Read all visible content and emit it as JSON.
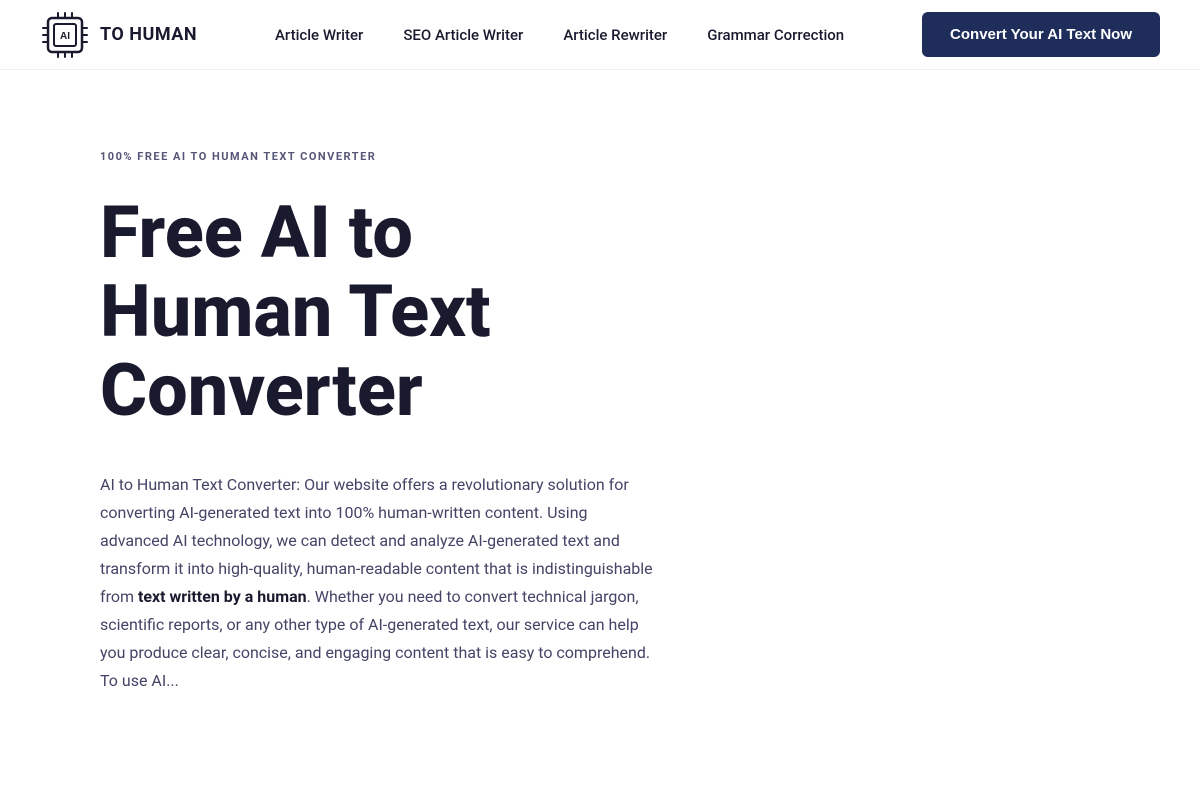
{
  "nav": {
    "logo_alt": "AI to Human Logo",
    "links": [
      {
        "label": "Article Writer",
        "href": "#"
      },
      {
        "label": "SEO Article Writer",
        "href": "#"
      },
      {
        "label": "Article Rewriter",
        "href": "#"
      },
      {
        "label": "Grammar Correction",
        "href": "#"
      }
    ],
    "cta_label": "Convert Your AI Text Now"
  },
  "hero": {
    "badge": "100% FREE AI TO HUMAN TEXT CONVERTER",
    "title": "Free AI to Human Text Converter",
    "description_part1": "AI to Human Text Converter: Our website offers a revolutionary solution for converting AI-generated text into 100% human-written content. Using advanced AI technology, we can detect and analyze AI-generated text and transform it into high-quality, human-readable content that is indistinguishable from ",
    "description_bold": "text written by a human",
    "description_part2": ". Whether you need to convert technical jargon, scientific reports, or any other type of AI-generated text, our service can help you produce clear, concise, and engaging content that is easy to comprehend. To use AI..."
  }
}
